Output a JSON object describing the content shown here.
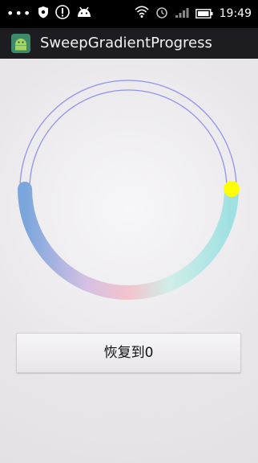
{
  "status_bar": {
    "time": "19:49",
    "left_icons": [
      "more-dots-icon",
      "shield-icon",
      "alert-circle-icon",
      "android-icon"
    ],
    "right_icons": [
      "wifi-icon",
      "alarm-icon",
      "signal-icon",
      "battery-icon"
    ]
  },
  "app": {
    "title": "SweepGradientProgress",
    "icon": "android-app-icon"
  },
  "progress": {
    "level": 0.5,
    "track_color": "#8f93ee",
    "gradient_colors": [
      "#7aa6dc",
      "#d6c0e4",
      "#f4c3cc",
      "#cfeee9",
      "#9fe0e2"
    ],
    "thumb_color": "#ffff00"
  },
  "button": {
    "label": "恢复到0"
  }
}
